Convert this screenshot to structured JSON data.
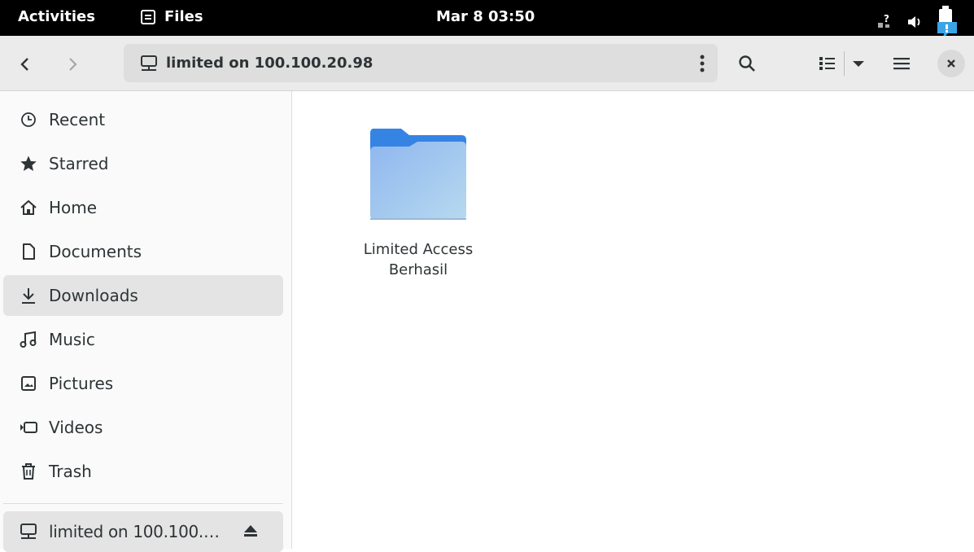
{
  "topbar": {
    "activities": "Activities",
    "app_name": "Files",
    "clock": "Mar 8  03:50",
    "icons": [
      "network-unknown-icon",
      "volume-icon",
      "battery-warning-icon"
    ]
  },
  "headerbar": {
    "location": "limited on 100.100.20.98",
    "icons": [
      "back-icon",
      "forward-icon",
      "network-drive-icon",
      "kebab-menu-icon",
      "search-icon",
      "list-view-icon",
      "chevron-down-icon",
      "hamburger-menu-icon",
      "close-icon"
    ]
  },
  "sidebar": {
    "items": [
      {
        "label": "Recent",
        "icon": "clock-icon"
      },
      {
        "label": "Starred",
        "icon": "star-icon"
      },
      {
        "label": "Home",
        "icon": "home-icon"
      },
      {
        "label": "Documents",
        "icon": "document-icon"
      },
      {
        "label": "Downloads",
        "icon": "download-icon",
        "selected": true
      },
      {
        "label": "Music",
        "icon": "music-icon"
      },
      {
        "label": "Pictures",
        "icon": "picture-icon"
      },
      {
        "label": "Videos",
        "icon": "video-icon"
      },
      {
        "label": "Trash",
        "icon": "trash-icon"
      }
    ],
    "mounts": [
      {
        "label": "limited on 100.100.…",
        "icon": "network-drive-icon",
        "action_icon": "eject-icon"
      }
    ]
  },
  "main": {
    "files": [
      {
        "name_line1": "Limited Access",
        "name_line2": "Berhasil",
        "type": "folder"
      }
    ]
  },
  "colors": {
    "topbar_bg": "#000000",
    "headerbar_bg": "#ebebeb",
    "folder_top": "#3584e4",
    "folder_body": "#a4c6f1",
    "sidebar_selected": "#e4e4e4"
  }
}
